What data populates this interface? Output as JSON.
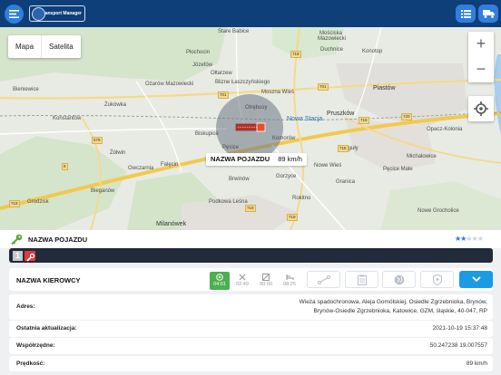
{
  "topbar": {
    "logo_text": "Transport Manager",
    "menu_icon": "hamburger-icon",
    "list_icon": "list-icon",
    "truck_icon": "truck-icon"
  },
  "map": {
    "type_buttons": [
      "Mapa",
      "Satelita"
    ],
    "zoom_in": "+",
    "zoom_out": "−",
    "vehicle_label": {
      "name": "NAZWA POJAZDU",
      "speed": "89 km/h"
    },
    "towns": [
      "Stare Babice",
      "Józefów",
      "Mościska",
      "Mazowiecki",
      "Duchnice",
      "Konotop",
      "Piastów",
      "Ożarów Mazowiecki",
      "Blizne Łaszczyńskiego",
      "Bieniewice",
      "Płochocin",
      "Ołtarzew",
      "Pruszków",
      "Konstantów",
      "Żukówka",
      "Moszna Wieś",
      "Nowa Stacja",
      "Otrębusy",
      "Biskupice",
      "Komorów",
      "Reguły",
      "Pęcice",
      "Nowe Wieś",
      "Pęcice Małe",
      "Michałowice",
      "Falęcin",
      "Żółwin",
      "Gorzyce",
      "Owczarnia",
      "Brwinów",
      "Granica",
      "Podkowa Leśna",
      "Milanówek",
      "Bieganów",
      "Grodzisk",
      "Rokitno",
      "Nowe Grocholice",
      "Opacz-Kolonia"
    ],
    "roads": [
      "719",
      "701",
      "701",
      "579",
      "719",
      "720",
      "718",
      "719",
      "719",
      "8",
      "719"
    ]
  },
  "panel": {
    "vehicle_name": "NAZWA POJAZDU",
    "rating": 2,
    "rating_max": 5,
    "vehicle_number": "1",
    "driver_label": "NAZWA KIEROWCY",
    "stats": [
      {
        "icon": "drive-icon",
        "time": "04:01",
        "active": true
      },
      {
        "icon": "work-tools-icon",
        "time": "02:49",
        "active": false
      },
      {
        "icon": "availability-icon",
        "time": "00:00",
        "active": false
      },
      {
        "icon": "rest-bed-icon",
        "time": "08:25",
        "active": false
      }
    ],
    "actions": [
      "route-icon",
      "clipboard-icon",
      "map-layers-icon",
      "shield-icon"
    ],
    "expand_icon": "chevron-down-icon"
  },
  "info": {
    "address_label": "Adres:",
    "address_line1": "Wieża spadochronowa, Aleja Gomólskiej, Osiedle Zgrzebnioka, Brynów,",
    "address_line2": "Brynów-Osiedle Zgrzebnioka, Katowice, GZM, śląskie, 40-047, RP",
    "updated_label": "Ostatnia aktualizacja:",
    "updated_value": "2021-10-19 15:37:48",
    "coords_label": "Współrzędne:",
    "coords_value": "50.247238 19.007557",
    "speed_label": "Prędkość:",
    "speed_value": "89 km/h"
  }
}
